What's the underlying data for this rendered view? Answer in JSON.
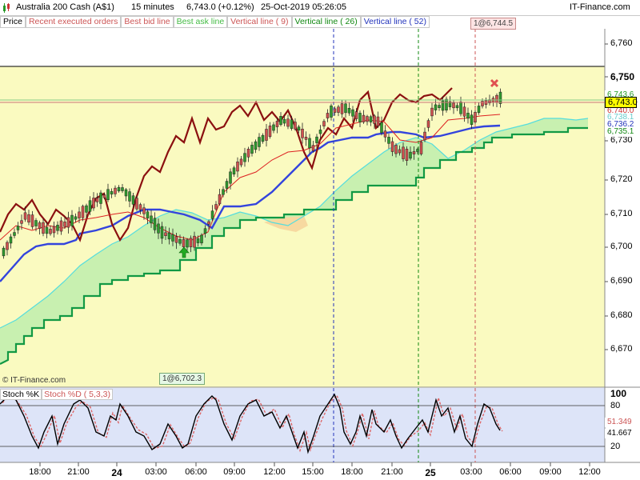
{
  "title": {
    "instrument": "Australia 200 Cash (A$1)",
    "timeframe": "15 minutes",
    "price": "6,743.0 (+0.12%)",
    "datetime": "25-Oct-2019 05:26:05",
    "brand": "IT-Finance.com"
  },
  "legend": [
    {
      "label": "Price",
      "color": "#000000"
    },
    {
      "label": "Recent executed orders",
      "color": "#cc5555"
    },
    {
      "label": "Best bid line",
      "color": "#cc5555"
    },
    {
      "label": "Best ask line",
      "color": "#44bb44"
    },
    {
      "label": "Vertical line ( 9)",
      "color": "#cc5555"
    },
    {
      "label": "Vertical line ( 26)",
      "color": "#118811"
    },
    {
      "label": "Vertical line ( 52)",
      "color": "#2233bb"
    }
  ],
  "watermark": "© IT-Finance.com",
  "callouts": {
    "top": "1@6,744.5",
    "bottom": "1@6,702.3"
  },
  "price_axis": [
    "6,760",
    "6,750",
    "6,740",
    "6,730",
    "6,720",
    "6,710",
    "6,700",
    "6,690",
    "6,680",
    "6,670"
  ],
  "price_boxes": [
    {
      "label": "6,743.6",
      "bg": "#ffffff",
      "fg": "#229922"
    },
    {
      "label": "6,743.0",
      "bg": "#ffff00",
      "fg": "#000000"
    },
    {
      "label": "6,740.0",
      "bg": "#ffffff",
      "fg": "#cc3333"
    },
    {
      "label": "6,738.1",
      "bg": "#ffffff",
      "fg": "#66cccc"
    },
    {
      "label": "6,736.2",
      "bg": "#ffffff",
      "fg": "#2233bb"
    },
    {
      "label": "6,735.1",
      "bg": "#ffffff",
      "fg": "#118811"
    }
  ],
  "stoch": {
    "legend_k": "Stoch %K",
    "legend_d": "Stoch %D ( 5,3,3)",
    "axis": [
      "100",
      "80",
      "20"
    ],
    "value_d": "51.349",
    "value_k": "41.667"
  },
  "time_axis": [
    "18:00",
    "21:00",
    "24",
    "03:00",
    "06:00",
    "09:00",
    "12:00",
    "15:00",
    "18:00",
    "21:00",
    "25",
    "03:00",
    "06:00",
    "09:00",
    "12:00"
  ]
}
